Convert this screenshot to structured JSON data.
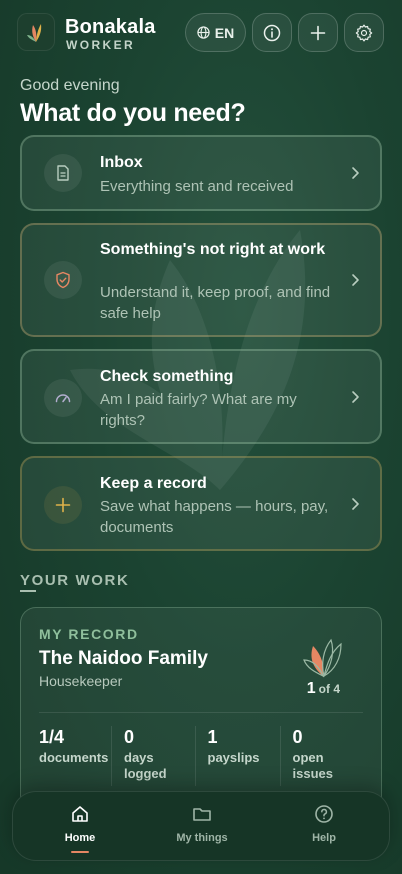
{
  "header": {
    "brand_name": "Bonakala",
    "brand_sub": "WORKER",
    "language_label": "EN"
  },
  "greeting": {
    "subtitle": "Good evening",
    "title": "What do you need?"
  },
  "actions": [
    {
      "title": "Inbox",
      "subtitle": "Everything sent and received",
      "icon": "document-icon"
    },
    {
      "title": "Something's not right at work",
      "subtitle": "Understand it, keep proof, and find safe help",
      "icon": "shield-check-icon"
    },
    {
      "title": "Check something",
      "subtitle": "Am I paid fairly? What are my rights?",
      "icon": "gauge-icon"
    },
    {
      "title": "Keep a record",
      "subtitle": "Save what happens — hours, pay, documents",
      "icon": "plus-icon"
    }
  ],
  "section": {
    "title": "YOUR WORK"
  },
  "record": {
    "label": "MY RECORD",
    "employer": "The Naidoo Family",
    "role": "Housekeeper",
    "count_current": "1",
    "count_total": "of 4",
    "stats": [
      {
        "value": "1/4",
        "label": "documents"
      },
      {
        "value": "0",
        "label": "days logged"
      },
      {
        "value": "1",
        "label": "payslips"
      },
      {
        "value": "0",
        "label": "open issues"
      }
    ]
  },
  "nav": {
    "items": [
      {
        "label": "Home",
        "icon": "home-icon",
        "active": true
      },
      {
        "label": "My things",
        "icon": "folder-icon",
        "active": false
      },
      {
        "label": "Help",
        "icon": "help-circle-icon",
        "active": false
      }
    ]
  },
  "colors": {
    "background": "#1b4331",
    "accent_orange": "#e58763",
    "accent_gold": "#e0b24a",
    "accent_green": "#8fbf9c"
  }
}
